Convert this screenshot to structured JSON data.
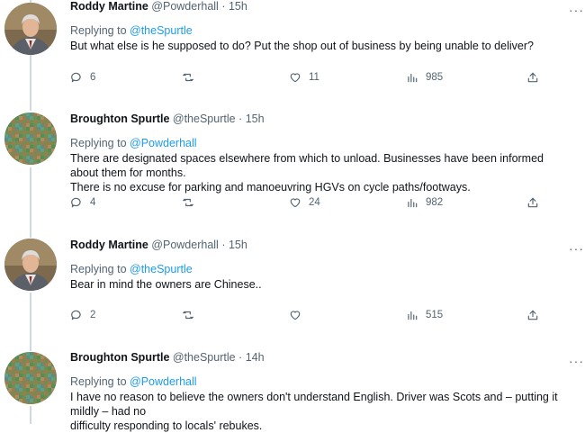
{
  "tweets": [
    {
      "name": "Roddy Martine",
      "handle": "@Powderhall",
      "time": "15h",
      "replying_prefix": "Replying to ",
      "replying_to": "@theSpurtle",
      "text": [
        "But what else is he supposed to do? Put the shop out of business by being unable to deliver?"
      ],
      "replies": "6",
      "retweets": "",
      "likes": "11",
      "views": "985",
      "avatar": "portrait"
    },
    {
      "name": "Broughton Spurtle",
      "handle": "@theSpurtle",
      "time": "15h",
      "replying_prefix": "Replying to ",
      "replying_to": "@Powderhall",
      "text": [
        "There are designated spaces elsewhere from which to unload. Businesses have been informed about them for months.",
        "There is no excuse for parking and manoeuvring HGVs on cycle paths/footways."
      ],
      "replies": "4",
      "retweets": "",
      "likes": "24",
      "views": "982",
      "avatar": "mosaic"
    },
    {
      "name": "Roddy Martine",
      "handle": "@Powderhall",
      "time": "15h",
      "replying_prefix": "Replying to ",
      "replying_to": "@theSpurtle",
      "text": [
        "Bear in mind the owners are Chinese.."
      ],
      "replies": "2",
      "retweets": "",
      "likes": "",
      "views": "515",
      "avatar": "portrait"
    },
    {
      "name": "Broughton Spurtle",
      "handle": "@theSpurtle",
      "time": "14h",
      "replying_prefix": "Replying to ",
      "replying_to": "@Powderhall",
      "text": [
        "I have no reason to believe the owners don't understand English. Driver was Scots and – putting it mildly – had no",
        "difficulty responding to locals' rebukes."
      ],
      "replies": "",
      "retweets": "",
      "likes": "",
      "views": "",
      "avatar": "mosaic"
    }
  ],
  "separator": "·",
  "more_glyph": "···",
  "colors": {
    "link": "#1d9bf0",
    "muted": "#536471",
    "text": "#0f1419",
    "thread_line": "#cfd9de"
  }
}
